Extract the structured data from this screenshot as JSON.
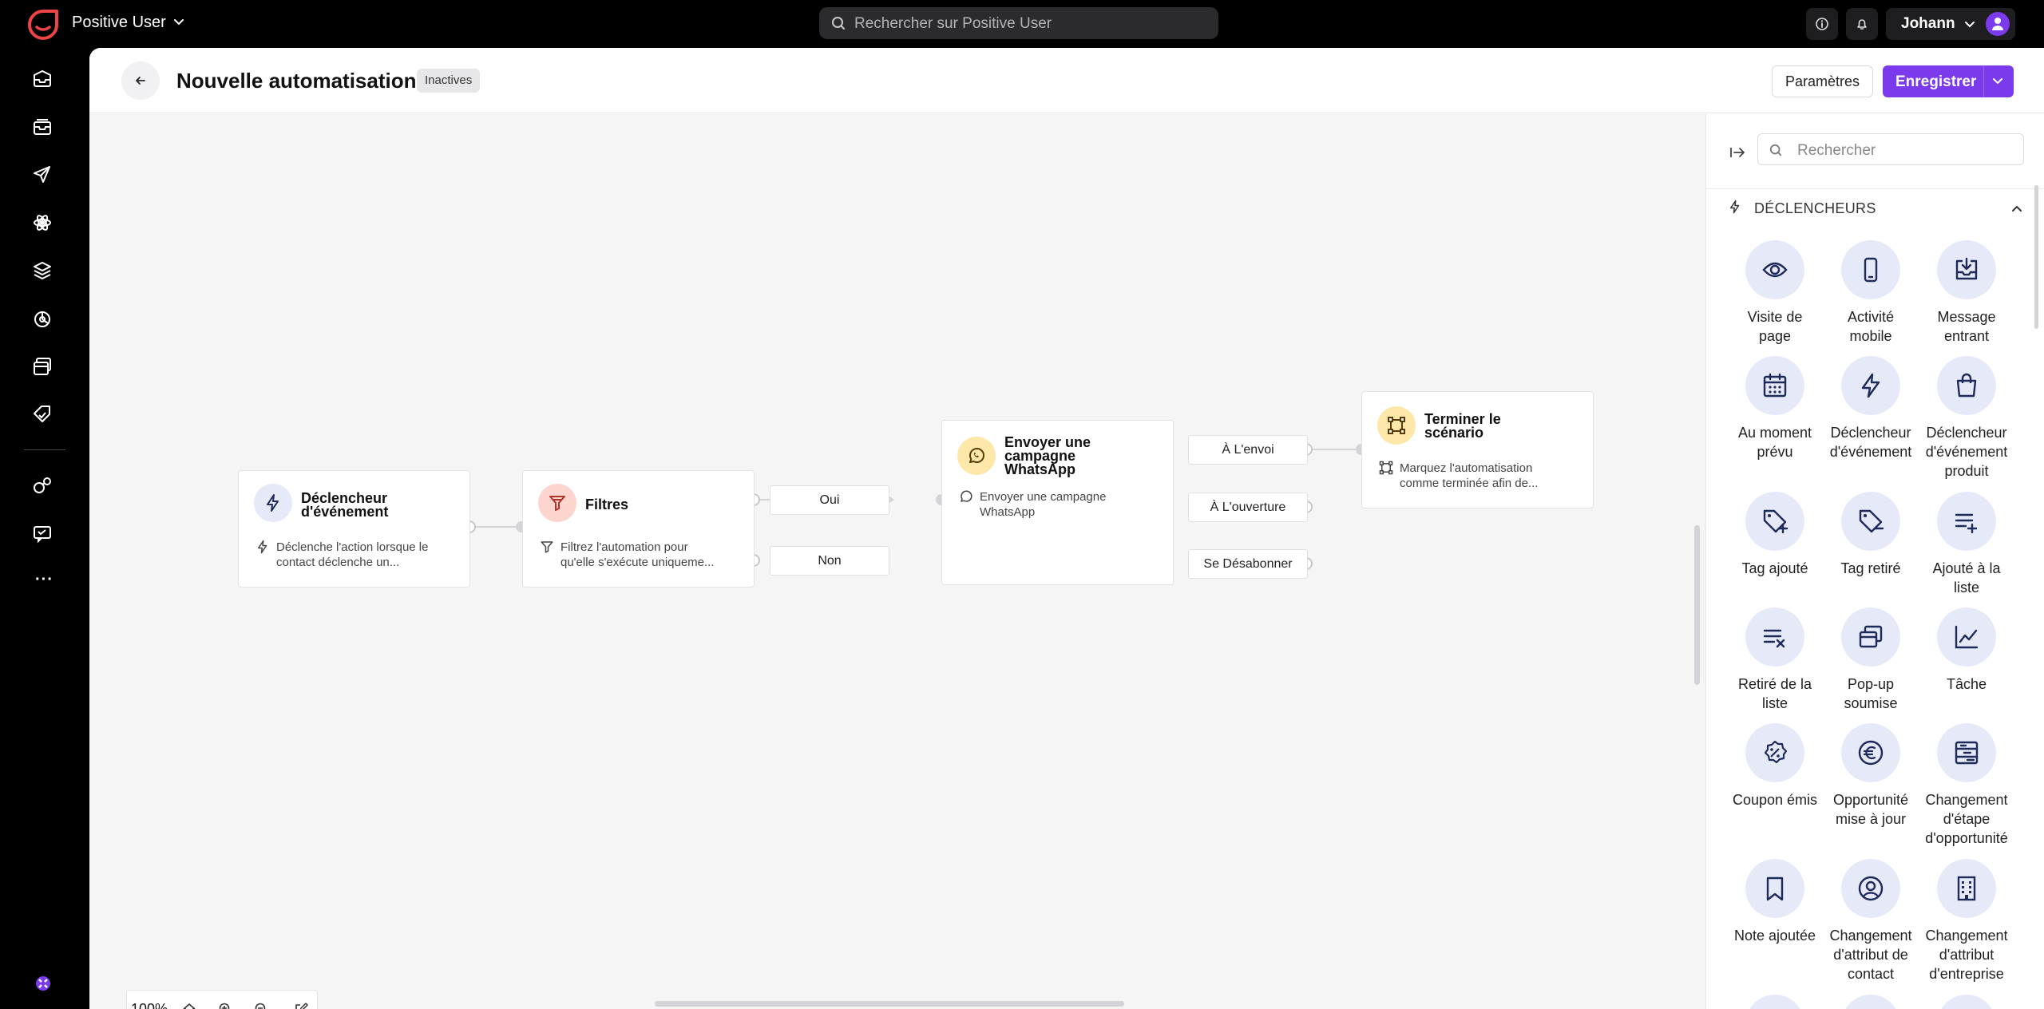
{
  "topbar": {
    "app_name": "Positive User",
    "search_placeholder": "Rechercher sur Positive User",
    "user_name": "Johann"
  },
  "header": {
    "title": "Nouvelle automatisation",
    "status_badge": "Inactives",
    "params_label": "Paramètres",
    "save_label": "Enregistrer"
  },
  "nodes": {
    "trigger": {
      "title_line1": "Déclencheur",
      "title_line2": "d'événement",
      "desc_line1": "Déclenche l'action lorsque le",
      "desc_line2": "contact déclenche un..."
    },
    "filter": {
      "title": "Filtres",
      "desc_line1": "Filtrez l'automation pour",
      "desc_line2": "qu'elle s'exécute uniqueme..."
    },
    "whatsapp": {
      "title_line1": "Envoyer une",
      "title_line2": "campagne",
      "title_line3": "WhatsApp",
      "desc_line1": "Envoyer une campagne",
      "desc_line2": "WhatsApp"
    },
    "end": {
      "title_line1": "Terminer le",
      "title_line2": "scénario",
      "desc_line1": "Marquez l'automatisation",
      "desc_line2": "comme terminée afin de..."
    }
  },
  "outputs": {
    "yes": "Oui",
    "no": "Non",
    "on_send": "À L'envoi",
    "on_open": "À L'ouverture",
    "unsubscribe": "Se Désabonner"
  },
  "zoom": {
    "value": "100%"
  },
  "panel": {
    "search_placeholder": "Rechercher",
    "section_title": "DÉCLENCHEURS",
    "tiles": [
      {
        "icon": "eye-icon",
        "line1": "Visite de",
        "line2": "page",
        "line3": ""
      },
      {
        "icon": "mobile-icon",
        "line1": "Activité",
        "line2": "mobile",
        "line3": ""
      },
      {
        "icon": "message-in-icon",
        "line1": "Message",
        "line2": "entrant",
        "line3": ""
      },
      {
        "icon": "calendar-icon",
        "line1": "Au moment",
        "line2": "prévu",
        "line3": ""
      },
      {
        "icon": "bolt-icon",
        "line1": "Déclencheur",
        "line2": "d'événement",
        "line3": ""
      },
      {
        "icon": "bag-icon",
        "line1": "Déclencheur",
        "line2": "d'événement",
        "line3": "produit"
      },
      {
        "icon": "tag-add-icon",
        "line1": "Tag ajouté",
        "line2": "",
        "line3": ""
      },
      {
        "icon": "tag-remove-icon",
        "line1": "Tag retiré",
        "line2": "",
        "line3": ""
      },
      {
        "icon": "list-add-icon",
        "line1": "Ajouté à la",
        "line2": "liste",
        "line3": ""
      },
      {
        "icon": "list-remove-icon",
        "line1": "Retiré de la",
        "line2": "liste",
        "line3": ""
      },
      {
        "icon": "popup-icon",
        "line1": "Pop-up",
        "line2": "soumise",
        "line3": ""
      },
      {
        "icon": "chart-icon",
        "line1": "Tâche",
        "line2": "",
        "line3": ""
      },
      {
        "icon": "coupon-icon",
        "line1": "Coupon émis",
        "line2": "",
        "line3": ""
      },
      {
        "icon": "euro-icon",
        "line1": "Opportunité",
        "line2": "mise à jour",
        "line3": ""
      },
      {
        "icon": "pipeline-icon",
        "line1": "Changement",
        "line2": "d'étape",
        "line3": "d'opportunité"
      },
      {
        "icon": "bookmark-icon",
        "line1": "Note ajoutée",
        "line2": "",
        "line3": ""
      },
      {
        "icon": "user-circle-icon",
        "line1": "Changement",
        "line2": "d'attribut de",
        "line3": "contact"
      },
      {
        "icon": "building-icon",
        "line1": "Changement",
        "line2": "d'attribut",
        "line3": "d'entreprise"
      }
    ]
  },
  "colors": {
    "accent": "#7c3aed",
    "logo": "#ef4444",
    "tile_bg": "#e6eaf8",
    "tile_icon": "#1e2a5a"
  }
}
